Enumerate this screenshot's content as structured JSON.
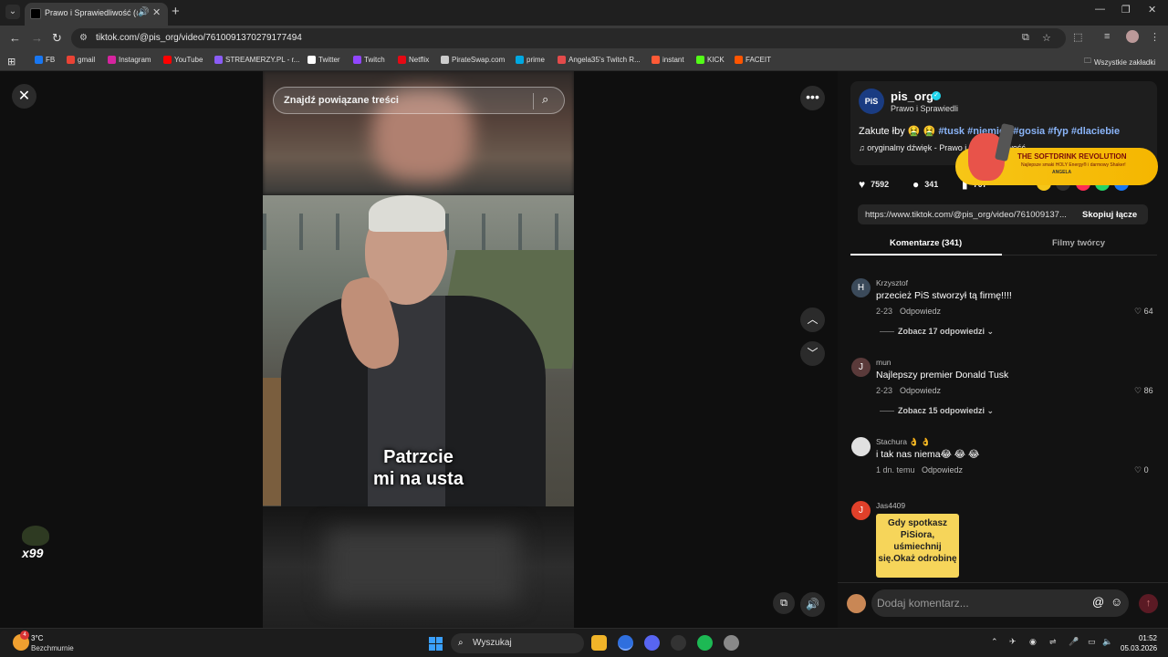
{
  "browser": {
    "tab_title": "Prawo i Sprawiedliwość (@pis_org)",
    "tab_audio": "🔊",
    "tab_close": "✕",
    "new_tab": "+",
    "url": "tiktok.com/@pis_org/video/7610091370279177494",
    "bookmarks": [
      {
        "label": "FB",
        "color": "#1877f2"
      },
      {
        "label": "gmail",
        "color": "#ea4335"
      },
      {
        "label": "Instagram",
        "color": "#d6249f"
      },
      {
        "label": "YouTube",
        "color": "#ff0000"
      },
      {
        "label": "STREAMERZY.PL - r...",
        "color": "#8b5cf6"
      },
      {
        "label": "Twitter",
        "color": "#ffffff"
      },
      {
        "label": "Twitch",
        "color": "#9146ff"
      },
      {
        "label": "Netflix",
        "color": "#e50914"
      },
      {
        "label": "PirateSwap.com",
        "color": "#cccccc"
      },
      {
        "label": "prime",
        "color": "#00a8e1"
      },
      {
        "label": "Angela35's Twitch R...",
        "color": "#e34b4b"
      },
      {
        "label": "instant",
        "color": "#ff5a36"
      },
      {
        "label": "KICK",
        "color": "#53fc18"
      },
      {
        "label": "FACEIT",
        "color": "#ff5500"
      }
    ],
    "all_bookmarks": "Wszystkie zakładki"
  },
  "video": {
    "search_placeholder": "Znajdź powiązane treści",
    "caption_line1": "Patrzcie",
    "caption_line2": "mi na usta",
    "badge": "x99"
  },
  "post": {
    "author": "pis_org",
    "author_sub": "Prawo i Sprawiedli",
    "avatar_text": "PiS",
    "description_prefix": "Zakute łby 🤮 🤮 ",
    "hashtags": [
      "#tusk",
      "#niemiec",
      "#gosia",
      "#fyp",
      "#dlaciebie"
    ],
    "sound": "oryginalny dźwięk - Prawo i Sprawiedliwość",
    "likes": "7592",
    "comments": "341",
    "saves": "707",
    "link": "https://www.tiktok.com/@pis_org/video/761009137...",
    "copy_label": "Skopiuj łącze"
  },
  "ad": {
    "title": "THE SOFTDRINK REVOLUTION",
    "subtitle": "Najlepsze smaki HOLY Energy® i darmowy Shaker!",
    "name": "ANGELA"
  },
  "tabs": {
    "comments": "Komentarze (341)",
    "creator_videos": "Filmy twórcy"
  },
  "comments": [
    {
      "initial": "H",
      "color": "#3b4a5a",
      "user": "Krzysztof",
      "text": "przecież PiS stworzył tą firmę!!!!",
      "date": "2-23",
      "reply": "Odpowiedz",
      "likes": "64",
      "more": "Zobacz 17 odpowiedzi"
    },
    {
      "initial": "J",
      "color": "#5a3a3a",
      "user": "mun",
      "text": "Najlepszy premier Donald Tusk",
      "date": "2-23",
      "reply": "Odpowiedz",
      "likes": "86",
      "more": "Zobacz 15 odpowiedzi"
    },
    {
      "initial": "",
      "color": "#e0e0e0",
      "user": "Stachura 👌 👌",
      "text": "i tak nas niema😂 😂 😂",
      "date": "1 dn. temu",
      "reply": "Odpowiedz",
      "likes": "0",
      "more": ""
    },
    {
      "initial": "J",
      "color": "#e0402a",
      "user": "Jas4409",
      "sticker": "Gdy spotkasz PiSiora, uśmiechnij się.Okaż odrobinę"
    }
  ],
  "comment_input_placeholder": "Dodaj komentarz...",
  "taskbar": {
    "temp": "3°C",
    "weather": "Bezchmurnie",
    "search": "Wyszukaj",
    "time": "01:52",
    "date": "05.03.2026",
    "weather_badge": "4"
  }
}
